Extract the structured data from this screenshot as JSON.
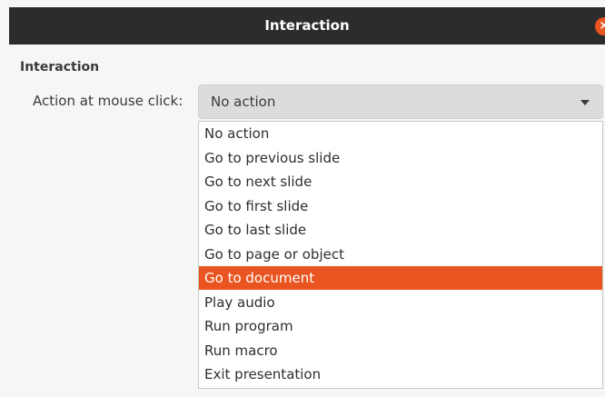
{
  "window": {
    "title": "Interaction",
    "close_symbol": "×"
  },
  "section": {
    "title": "Interaction"
  },
  "action_field": {
    "label": "Action at mouse click:",
    "value": "No action"
  },
  "dropdown": {
    "highlighted_index": 6,
    "options": [
      "No action",
      "Go to previous slide",
      "Go to next slide",
      "Go to first slide",
      "Go to last slide",
      "Go to page or object",
      "Go to document",
      "Play audio",
      "Run program",
      "Run macro",
      "Exit presentation"
    ]
  },
  "colors": {
    "accent": "#e95420",
    "titlebar": "#2c2c2c"
  },
  "icons": {
    "close": "close-icon",
    "dropdown_arrow": "chevron-down-icon"
  }
}
